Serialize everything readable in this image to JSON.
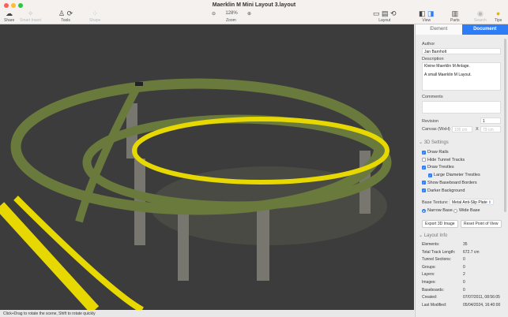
{
  "window": {
    "title": "Maerklin M Mini Layout 3.layout"
  },
  "toolbar": {
    "share": "Share",
    "smart_insert": "Smart Insert",
    "tools": "Tools",
    "shape": "Shape",
    "zoom_label": "Zoom",
    "zoom_value": "128%",
    "layout": "Layout",
    "view": "View",
    "parts": "Parts",
    "search": "Search",
    "tips": "Tips"
  },
  "status": "Click+Drag to rotate the scene, Shift to rotate quickly",
  "sidebar": {
    "tabs": [
      "Element",
      "Document"
    ],
    "author_label": "Author",
    "author": "Jan Barnholt",
    "description_label": "Description",
    "description_1": "Kleine Maerklin M Anlage.",
    "description_2": "A small Maerklin M Layout.",
    "comments_label": "Comments",
    "revision_label": "Revision",
    "revision": "1",
    "canvas_label": "Canvas (WxH)",
    "canvas_w": "105 cm",
    "canvas_x": "X",
    "canvas_h": "79 cm",
    "settings_title": "3D Settings",
    "checks": [
      {
        "label": "Draw Rails",
        "on": true
      },
      {
        "label": "Hide Tunnel Tracks",
        "on": false
      },
      {
        "label": "Draw Trestles",
        "on": true
      },
      {
        "label": "Large Diameter Trestles",
        "on": true
      },
      {
        "label": "Show Baseboard Borders",
        "on": true
      },
      {
        "label": "Darker Background",
        "on": true
      }
    ],
    "base_texture_label": "Base Texture:",
    "base_texture": "Metal Anti-Slip Plate",
    "narrow": "Narrow Base",
    "wide": "Wide Base",
    "export": "Export 3D Image",
    "reset": "Reset Point of View",
    "info_title": "Layout Info",
    "info": [
      [
        "Elements:",
        "35"
      ],
      [
        "Total Track Length:",
        "672.7 cm"
      ],
      [
        "Tunnel Sections:",
        "0"
      ],
      [
        "Groups:",
        "0"
      ],
      [
        "Layers:",
        "2"
      ],
      [
        "Images:",
        "0"
      ],
      [
        "Baseboards:",
        "0"
      ],
      [
        "Created:",
        "07/07/2011, 08:56:05"
      ],
      [
        "Last Modified:",
        "05/04/2024, 16:40:00"
      ]
    ]
  }
}
